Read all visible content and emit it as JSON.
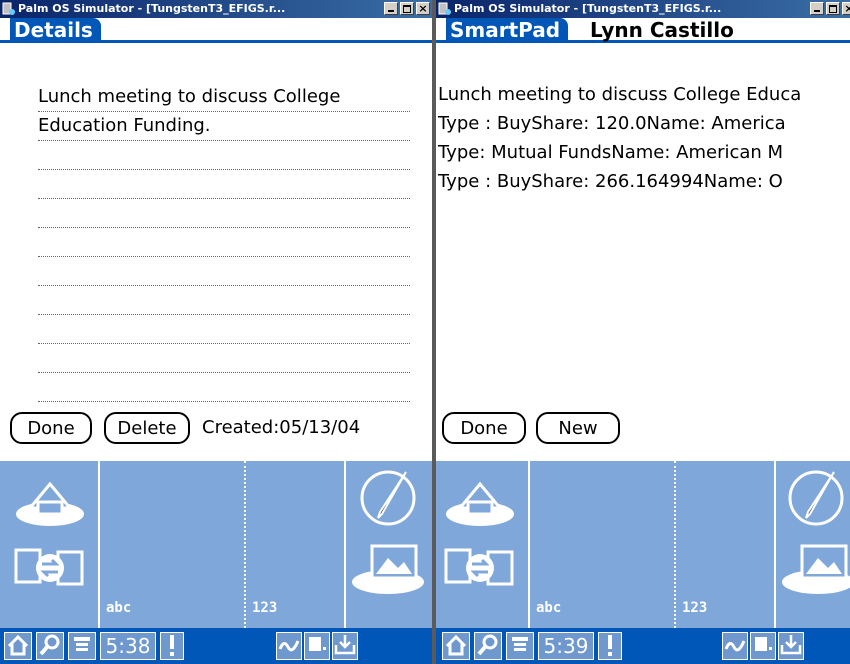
{
  "windows": [
    {
      "title": "Palm OS Simulator - [TungstenT3_EFIGS.r...",
      "app_tab": "Details",
      "note_lines": [
        "Lunch meeting to discuss College",
        "Education Funding."
      ],
      "buttons": {
        "done": "Done",
        "delete": "Delete"
      },
      "created": "Created:05/13/04",
      "silk_labels": {
        "abc": "abc",
        "num": "123"
      },
      "time": "5:38"
    },
    {
      "title": "Palm OS Simulator - [TungstenT3_EFIGS.r...",
      "app_tab": "SmartPad",
      "header_name": "Lynn Castillo",
      "pad_lines": [
        "Lunch meeting to discuss College Educa",
        "Type : BuyShare: 120.0Name: America",
        "Type: Mutual FundsName: American M",
        "Type : BuyShare: 266.164994Name: O"
      ],
      "buttons": {
        "done": "Done",
        "new": "New"
      },
      "silk_labels": {
        "abc": "abc",
        "num": "123"
      },
      "time": "5:39"
    }
  ],
  "titlebar_buttons": {
    "close": "×"
  },
  "icons": [
    "palm-app-icon",
    "minimize-icon",
    "maximize-icon",
    "close-icon",
    "home-icon",
    "sync-icon",
    "pen-icon",
    "picture-icon",
    "home-status-icon",
    "search-icon",
    "menu-icon",
    "alert-icon",
    "graffiti-icon",
    "device-icon",
    "input-icon"
  ],
  "colors": {
    "palm_blue": "#0057b8",
    "silk_blue": "#7fa7d9",
    "titlebar": "#0a246a"
  }
}
